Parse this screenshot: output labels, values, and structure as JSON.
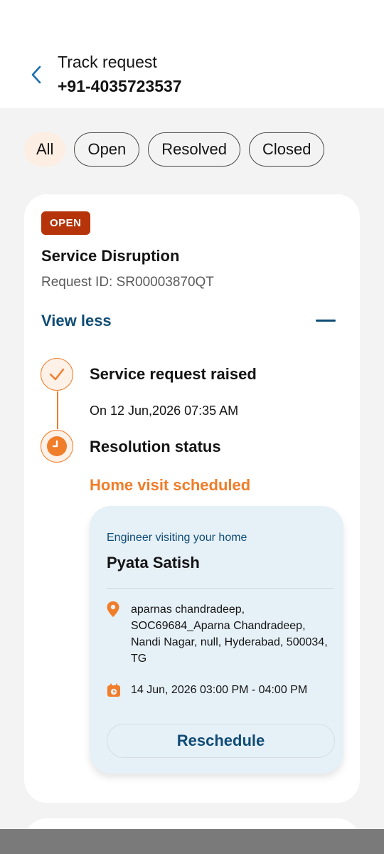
{
  "header": {
    "title": "Track request",
    "subtitle": "+91-4035723537",
    "back_icon": "chevron-left-icon"
  },
  "filters": [
    {
      "label": "All",
      "active": true
    },
    {
      "label": "Open",
      "active": false
    },
    {
      "label": "Resolved",
      "active": false
    },
    {
      "label": "Closed",
      "active": false
    }
  ],
  "request": {
    "status_badge": "OPEN",
    "title": "Service Disruption",
    "request_id": "Request ID: SR00003870QT",
    "view_toggle": "View less",
    "timeline": [
      {
        "title": "Service request raised",
        "detail": "On 12 Jun,2026 07:35 AM",
        "icon": "check-icon"
      },
      {
        "title": "Resolution status",
        "detail": "Home visit scheduled",
        "icon": "clock-icon"
      }
    ],
    "visit": {
      "label": "Engineer visiting your home",
      "engineer": "Pyata Satish",
      "address": "aparnas chandradeep, SOC69684_Aparna Chandradeep, Nandi Nagar, null, Hyderabad, 500034, TG",
      "time": "14 Jun, 2026 03:00 PM - 04:00 PM",
      "action": "Reschedule"
    }
  },
  "colors": {
    "accent_orange": "#f07d2a",
    "badge_red": "#b53409",
    "link_blue": "#0f4c75",
    "visit_bg": "#e6f0f7",
    "page_bg": "#f3f3f3"
  }
}
